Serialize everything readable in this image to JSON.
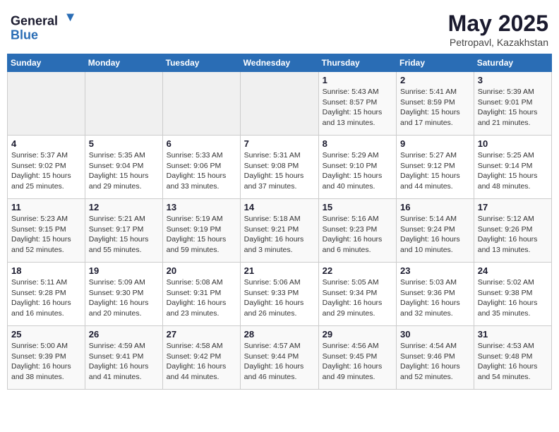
{
  "header": {
    "logo_general": "General",
    "logo_blue": "Blue",
    "title": "May 2025",
    "subtitle": "Petropavl, Kazakhstan"
  },
  "days_of_week": [
    "Sunday",
    "Monday",
    "Tuesday",
    "Wednesday",
    "Thursday",
    "Friday",
    "Saturday"
  ],
  "weeks": [
    [
      {
        "day": "",
        "info": ""
      },
      {
        "day": "",
        "info": ""
      },
      {
        "day": "",
        "info": ""
      },
      {
        "day": "",
        "info": ""
      },
      {
        "day": "1",
        "info": "Sunrise: 5:43 AM\nSunset: 8:57 PM\nDaylight: 15 hours\nand 13 minutes."
      },
      {
        "day": "2",
        "info": "Sunrise: 5:41 AM\nSunset: 8:59 PM\nDaylight: 15 hours\nand 17 minutes."
      },
      {
        "day": "3",
        "info": "Sunrise: 5:39 AM\nSunset: 9:01 PM\nDaylight: 15 hours\nand 21 minutes."
      }
    ],
    [
      {
        "day": "4",
        "info": "Sunrise: 5:37 AM\nSunset: 9:02 PM\nDaylight: 15 hours\nand 25 minutes."
      },
      {
        "day": "5",
        "info": "Sunrise: 5:35 AM\nSunset: 9:04 PM\nDaylight: 15 hours\nand 29 minutes."
      },
      {
        "day": "6",
        "info": "Sunrise: 5:33 AM\nSunset: 9:06 PM\nDaylight: 15 hours\nand 33 minutes."
      },
      {
        "day": "7",
        "info": "Sunrise: 5:31 AM\nSunset: 9:08 PM\nDaylight: 15 hours\nand 37 minutes."
      },
      {
        "day": "8",
        "info": "Sunrise: 5:29 AM\nSunset: 9:10 PM\nDaylight: 15 hours\nand 40 minutes."
      },
      {
        "day": "9",
        "info": "Sunrise: 5:27 AM\nSunset: 9:12 PM\nDaylight: 15 hours\nand 44 minutes."
      },
      {
        "day": "10",
        "info": "Sunrise: 5:25 AM\nSunset: 9:14 PM\nDaylight: 15 hours\nand 48 minutes."
      }
    ],
    [
      {
        "day": "11",
        "info": "Sunrise: 5:23 AM\nSunset: 9:15 PM\nDaylight: 15 hours\nand 52 minutes."
      },
      {
        "day": "12",
        "info": "Sunrise: 5:21 AM\nSunset: 9:17 PM\nDaylight: 15 hours\nand 55 minutes."
      },
      {
        "day": "13",
        "info": "Sunrise: 5:19 AM\nSunset: 9:19 PM\nDaylight: 15 hours\nand 59 minutes."
      },
      {
        "day": "14",
        "info": "Sunrise: 5:18 AM\nSunset: 9:21 PM\nDaylight: 16 hours\nand 3 minutes."
      },
      {
        "day": "15",
        "info": "Sunrise: 5:16 AM\nSunset: 9:23 PM\nDaylight: 16 hours\nand 6 minutes."
      },
      {
        "day": "16",
        "info": "Sunrise: 5:14 AM\nSunset: 9:24 PM\nDaylight: 16 hours\nand 10 minutes."
      },
      {
        "day": "17",
        "info": "Sunrise: 5:12 AM\nSunset: 9:26 PM\nDaylight: 16 hours\nand 13 minutes."
      }
    ],
    [
      {
        "day": "18",
        "info": "Sunrise: 5:11 AM\nSunset: 9:28 PM\nDaylight: 16 hours\nand 16 minutes."
      },
      {
        "day": "19",
        "info": "Sunrise: 5:09 AM\nSunset: 9:30 PM\nDaylight: 16 hours\nand 20 minutes."
      },
      {
        "day": "20",
        "info": "Sunrise: 5:08 AM\nSunset: 9:31 PM\nDaylight: 16 hours\nand 23 minutes."
      },
      {
        "day": "21",
        "info": "Sunrise: 5:06 AM\nSunset: 9:33 PM\nDaylight: 16 hours\nand 26 minutes."
      },
      {
        "day": "22",
        "info": "Sunrise: 5:05 AM\nSunset: 9:34 PM\nDaylight: 16 hours\nand 29 minutes."
      },
      {
        "day": "23",
        "info": "Sunrise: 5:03 AM\nSunset: 9:36 PM\nDaylight: 16 hours\nand 32 minutes."
      },
      {
        "day": "24",
        "info": "Sunrise: 5:02 AM\nSunset: 9:38 PM\nDaylight: 16 hours\nand 35 minutes."
      }
    ],
    [
      {
        "day": "25",
        "info": "Sunrise: 5:00 AM\nSunset: 9:39 PM\nDaylight: 16 hours\nand 38 minutes."
      },
      {
        "day": "26",
        "info": "Sunrise: 4:59 AM\nSunset: 9:41 PM\nDaylight: 16 hours\nand 41 minutes."
      },
      {
        "day": "27",
        "info": "Sunrise: 4:58 AM\nSunset: 9:42 PM\nDaylight: 16 hours\nand 44 minutes."
      },
      {
        "day": "28",
        "info": "Sunrise: 4:57 AM\nSunset: 9:44 PM\nDaylight: 16 hours\nand 46 minutes."
      },
      {
        "day": "29",
        "info": "Sunrise: 4:56 AM\nSunset: 9:45 PM\nDaylight: 16 hours\nand 49 minutes."
      },
      {
        "day": "30",
        "info": "Sunrise: 4:54 AM\nSunset: 9:46 PM\nDaylight: 16 hours\nand 52 minutes."
      },
      {
        "day": "31",
        "info": "Sunrise: 4:53 AM\nSunset: 9:48 PM\nDaylight: 16 hours\nand 54 minutes."
      }
    ]
  ]
}
